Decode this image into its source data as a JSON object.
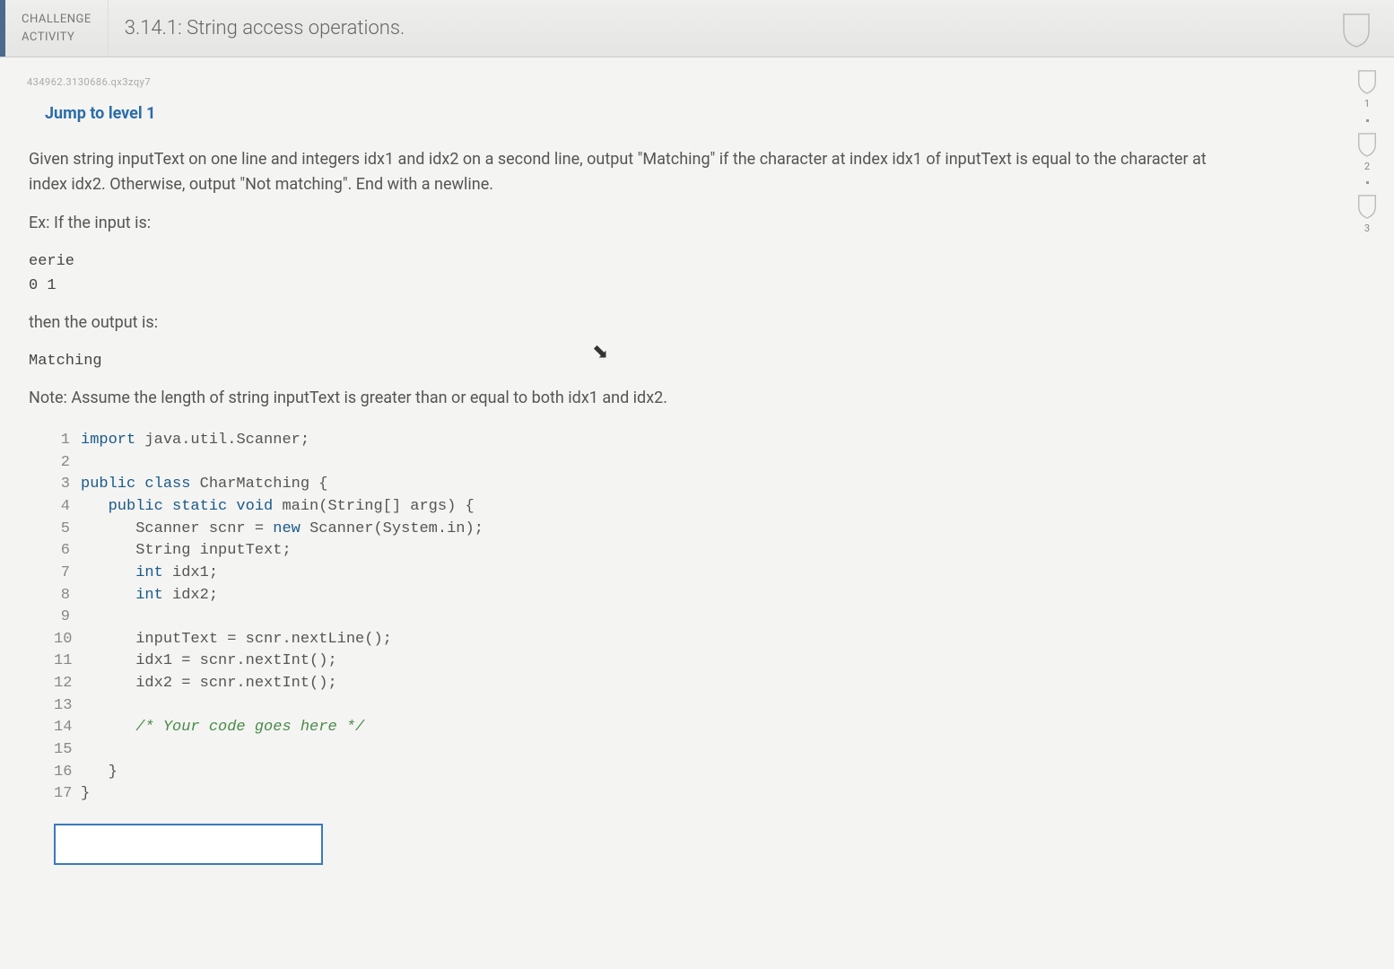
{
  "header": {
    "label1": "CHALLENGE",
    "label2": "ACTIVITY",
    "title": "3.14.1: String access operations."
  },
  "hash": "434962.3130686.qx3zqy7",
  "jump_link": "Jump to level 1",
  "levels": [
    "1",
    "2",
    "3"
  ],
  "instructions": {
    "p1": "Given string inputText on one line and integers idx1 and idx2 on a second line, output \"Matching\" if the character at index idx1 of inputText is equal to the character at index idx2. Otherwise, output \"Not matching\". End with a newline.",
    "ex_label": "Ex: If the input is:",
    "ex_input": "eerie\n0 1",
    "ex_then": "then the output is:",
    "ex_output": "Matching",
    "note": "Note: Assume the length of string inputText is greater than or equal to both idx1 and idx2."
  },
  "code": [
    {
      "n": "1",
      "pre": "",
      "tokens": [
        {
          "t": "import ",
          "c": "kw"
        },
        {
          "t": "java.util.Scanner;",
          "c": ""
        }
      ]
    },
    {
      "n": "2",
      "pre": "",
      "tokens": []
    },
    {
      "n": "3",
      "pre": "",
      "tokens": [
        {
          "t": "public class ",
          "c": "kw"
        },
        {
          "t": "CharMatching {",
          "c": ""
        }
      ]
    },
    {
      "n": "4",
      "pre": "   ",
      "tokens": [
        {
          "t": "public static void ",
          "c": "kw"
        },
        {
          "t": "main(String[] args) {",
          "c": ""
        }
      ]
    },
    {
      "n": "5",
      "pre": "      ",
      "tokens": [
        {
          "t": "Scanner scnr = ",
          "c": ""
        },
        {
          "t": "new ",
          "c": "kw"
        },
        {
          "t": "Scanner(System.in);",
          "c": ""
        }
      ]
    },
    {
      "n": "6",
      "pre": "      ",
      "tokens": [
        {
          "t": "String inputText;",
          "c": ""
        }
      ]
    },
    {
      "n": "7",
      "pre": "      ",
      "tokens": [
        {
          "t": "int ",
          "c": "kw"
        },
        {
          "t": "idx1;",
          "c": ""
        }
      ]
    },
    {
      "n": "8",
      "pre": "      ",
      "tokens": [
        {
          "t": "int ",
          "c": "kw"
        },
        {
          "t": "idx2;",
          "c": ""
        }
      ]
    },
    {
      "n": "9",
      "pre": "",
      "tokens": []
    },
    {
      "n": "10",
      "pre": "      ",
      "tokens": [
        {
          "t": "inputText = scnr.nextLine();",
          "c": ""
        }
      ]
    },
    {
      "n": "11",
      "pre": "      ",
      "tokens": [
        {
          "t": "idx1 = scnr.nextInt();",
          "c": ""
        }
      ]
    },
    {
      "n": "12",
      "pre": "      ",
      "tokens": [
        {
          "t": "idx2 = scnr.nextInt();",
          "c": ""
        }
      ]
    },
    {
      "n": "13",
      "pre": "",
      "tokens": []
    },
    {
      "n": "14",
      "pre": "      ",
      "tokens": [
        {
          "t": "/* Your code goes here */",
          "c": "comment"
        }
      ]
    },
    {
      "n": "15",
      "pre": "",
      "tokens": []
    },
    {
      "n": "16",
      "pre": "   ",
      "tokens": [
        {
          "t": "}",
          "c": ""
        }
      ]
    },
    {
      "n": "17",
      "pre": "",
      "tokens": [
        {
          "t": "}",
          "c": ""
        }
      ]
    }
  ]
}
